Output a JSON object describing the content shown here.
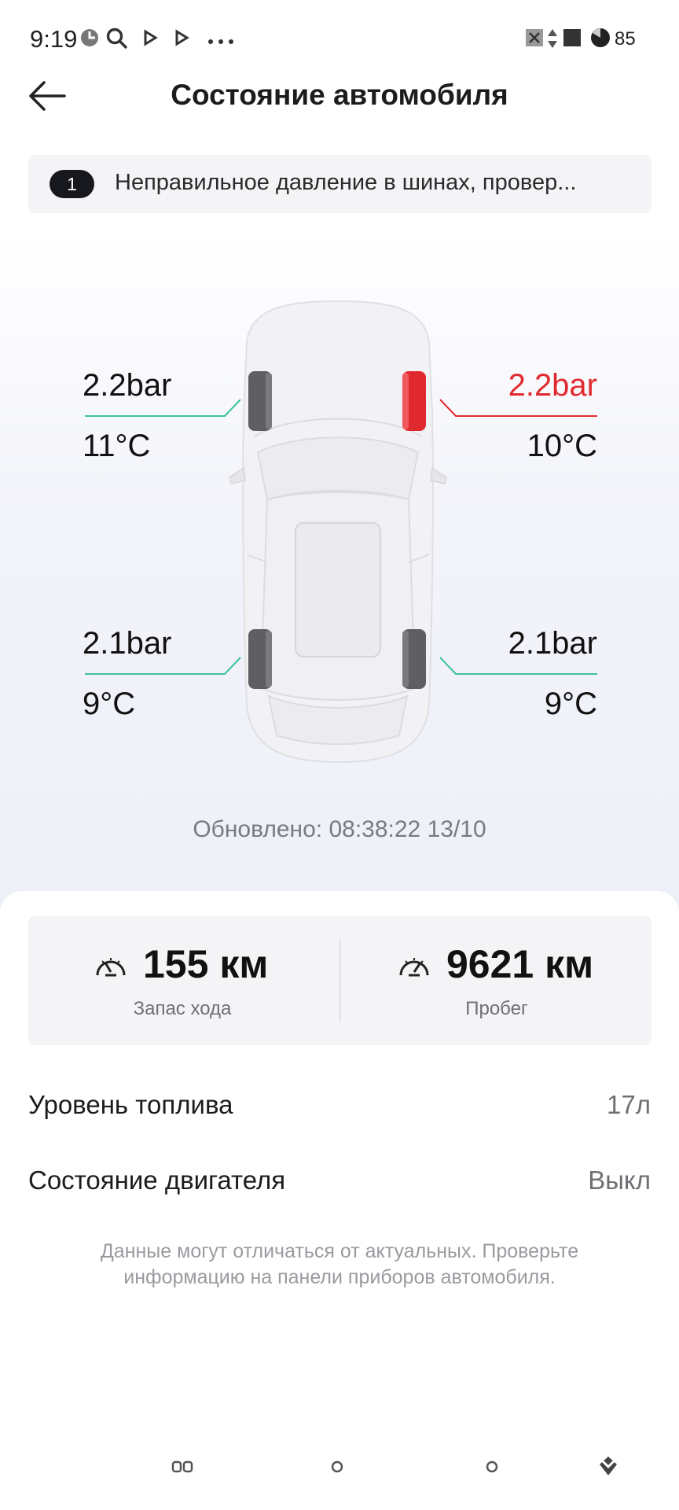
{
  "status_bar": {
    "time": "9:19",
    "battery": "85",
    "icons": [
      "clock-icon",
      "search-icon",
      "play-icon",
      "play-icon",
      "more-icon",
      "no-sim-icon",
      "data-arrows-icon",
      "square-icon",
      "battery-pie-icon"
    ]
  },
  "header": {
    "title": "Состояние автомобиля",
    "back_icon": "arrow-left-icon"
  },
  "alert": {
    "count": "1",
    "text": "Неправильное давление в шинах, провер..."
  },
  "tires": {
    "front_left": {
      "pressure": "2.2bar",
      "temperature": "11°C",
      "status": "ok"
    },
    "front_right": {
      "pressure": "2.2bar",
      "temperature": "10°C",
      "status": "alert"
    },
    "rear_left": {
      "pressure": "2.1bar",
      "temperature": "9°C",
      "status": "ok"
    },
    "rear_right": {
      "pressure": "2.1bar",
      "temperature": "9°C",
      "status": "ok"
    }
  },
  "updated": "Обновлено: 08:38:22 13/10",
  "stats": {
    "range": {
      "value": "155 км",
      "label": "Запас хода"
    },
    "mileage": {
      "value": "9621 км",
      "label": "Пробег"
    }
  },
  "rows": [
    {
      "label": "Уровень топлива",
      "value": "17л"
    },
    {
      "label": "Состояние двигателя",
      "value": "Выкл"
    }
  ],
  "disclaimer": "Данные могут отличаться от актуальных. Проверьте информацию на панели приборов автомобиля.",
  "colors": {
    "ok_line": "#3cc29b",
    "alert": "#e0292e",
    "tire": "#5f5f62"
  },
  "nav": [
    "recent-apps-icon",
    "home-icon",
    "back-circle-icon",
    "assistant-icon"
  ]
}
